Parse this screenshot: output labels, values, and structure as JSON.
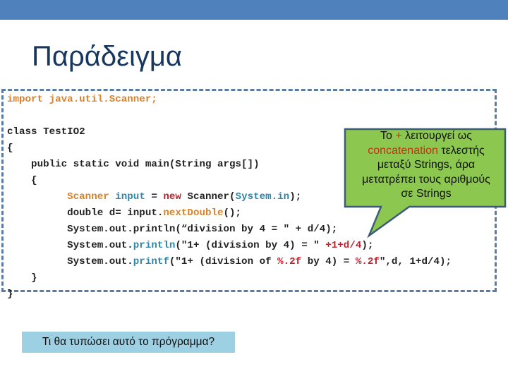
{
  "slide": {
    "title": "Παράδειγμα",
    "colors": {
      "topbar": "#4f81bd",
      "title": "#17375e",
      "code_border": "#5a7ca3",
      "callout_fill": "#8cc850",
      "callout_border": "#3d5a78",
      "question_fill": "#9dd0e3"
    }
  },
  "code": {
    "lines": [
      [
        {
          "t": "import java.util.Scanner;",
          "c": "orange"
        }
      ],
      [
        {
          "t": "",
          "c": ""
        }
      ],
      [
        {
          "t": "class TestIO2",
          "c": ""
        }
      ],
      [
        {
          "t": "{",
          "c": ""
        }
      ],
      [
        {
          "t": "    public static void main(String args[])",
          "c": ""
        }
      ],
      [
        {
          "t": "    {",
          "c": ""
        }
      ],
      [
        {
          "t": "          ",
          "c": ""
        },
        {
          "t": "Scanner",
          "c": "orange"
        },
        {
          "t": " ",
          "c": ""
        },
        {
          "t": "input",
          "c": "blue"
        },
        {
          "t": " = ",
          "c": ""
        },
        {
          "t": "new",
          "c": "red"
        },
        {
          "t": " Scanner(",
          "c": ""
        },
        {
          "t": "System.in",
          "c": "blue"
        },
        {
          "t": ");",
          "c": ""
        }
      ],
      [
        {
          "t": "          double d= input.",
          "c": ""
        },
        {
          "t": "nextDouble",
          "c": "orange"
        },
        {
          "t": "();",
          "c": ""
        }
      ],
      [
        {
          "t": "          System.out.println(“division by 4 = \" + d/4);",
          "c": ""
        }
      ],
      [
        {
          "t": "          System.out.",
          "c": ""
        },
        {
          "t": "println",
          "c": "blue"
        },
        {
          "t": "(\"1+ (division by 4) = \" ",
          "c": ""
        },
        {
          "t": "+1+d/4",
          "c": "red"
        },
        {
          "t": ");",
          "c": ""
        }
      ],
      [
        {
          "t": "          System.out.",
          "c": ""
        },
        {
          "t": "printf",
          "c": "blue"
        },
        {
          "t": "(\"1+ (division of ",
          "c": ""
        },
        {
          "t": "%.2f",
          "c": "red"
        },
        {
          "t": " by 4) = ",
          "c": ""
        },
        {
          "t": "%.2f",
          "c": "red"
        },
        {
          "t": "\",d, 1+d/4);",
          "c": ""
        }
      ],
      [
        {
          "t": "    }",
          "c": ""
        }
      ],
      [
        {
          "t": "}",
          "c": ""
        }
      ]
    ]
  },
  "callout": {
    "line1_pre": "Το ",
    "line1_plus": "+",
    "line1_post": " λειτουργεί ως",
    "line2_red": "concatenation",
    "line2_post": " τελεστής",
    "line3": "μεταξύ Strings, άρα",
    "line4": "μετατρέπει τους αριθμούς",
    "line5": "σε Strings"
  },
  "question": {
    "text": "Τι θα τυπώσει αυτό το πρόγραμμα?"
  }
}
